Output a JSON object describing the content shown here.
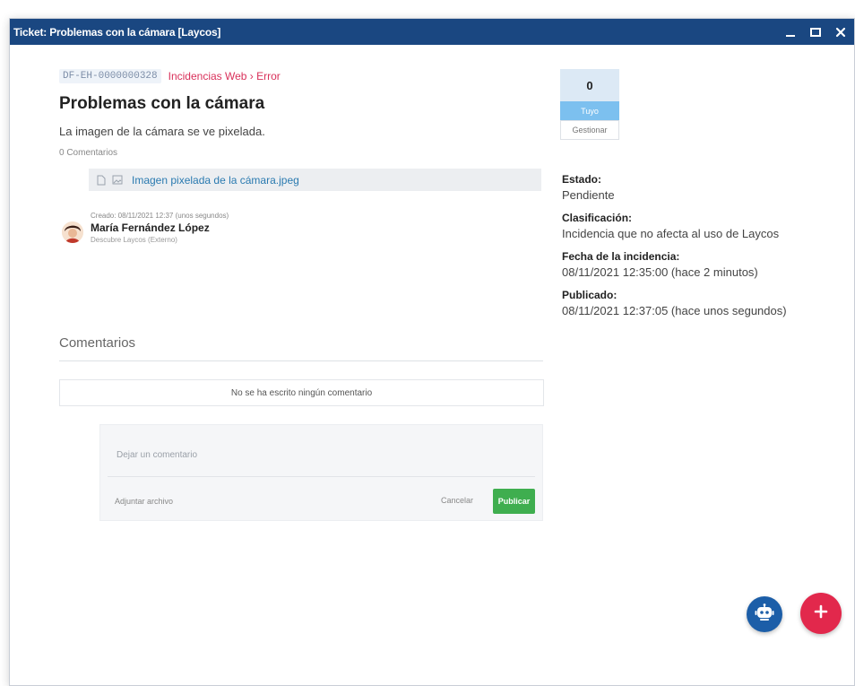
{
  "window": {
    "title": "Ticket: Problemas con la cámara [Laycos]",
    "controls": [
      "minimize-icon",
      "maximize-icon",
      "close-icon"
    ]
  },
  "ticket": {
    "code": "DF-EH-0000000328",
    "category": "Incidencias Web › Error",
    "title": "Problemas con la cámara",
    "description": "La imagen de la cámara se ve pixelada.",
    "comment_count": "0 Comentarios",
    "attachment": {
      "icons": [
        "file-icon",
        "image-icon"
      ],
      "name": "Imagen pixelada de la cámara.jpeg"
    },
    "author": {
      "created": "Creado: 08/11/2021 12:37 (unos segundos)",
      "name": "María Fernández López",
      "role": "Descubre Laycos (Externo)"
    }
  },
  "comments": {
    "heading": "Comentarios",
    "empty_text": "No se ha escrito ningún comentario",
    "input_placeholder": "Dejar un comentario",
    "attach_label": "Adjuntar archivo",
    "cancel_label": "Cancelar",
    "publish_label": "Publicar"
  },
  "stats": {
    "count": "0",
    "label": "Tuyo",
    "manage_label": "Gestionar"
  },
  "details": {
    "estado_label": "Estado:",
    "estado_value": "Pendiente",
    "clasificacion_label": "Clasificación:",
    "clasificacion_value": "Incidencia que no afecta al uso de Laycos",
    "fecha_label": "Fecha de la incidencia:",
    "fecha_value": "08/11/2021 12:35:00 (hace 2 minutos)",
    "publicado_label": "Publicado:",
    "publicado_value": "08/11/2021 12:37:05 (hace unos segundos)"
  },
  "fabs": {
    "bot_icon": "robot-icon",
    "add_icon": "plus-icon"
  },
  "colors": {
    "titlebar": "#1a4781",
    "category": "#d9305a",
    "link": "#2a7ab0",
    "publish": "#3fae4f",
    "stats_label": "#7cc0ef",
    "fab_bot": "#1c5ea8",
    "fab_add": "#e2284c"
  }
}
